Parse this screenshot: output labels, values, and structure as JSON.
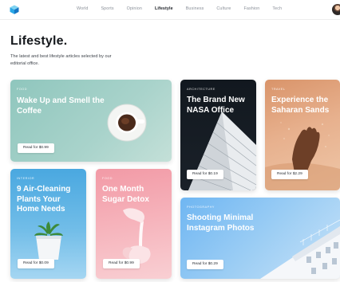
{
  "nav": {
    "items": [
      "World",
      "Sports",
      "Opinion",
      "Lifestyle",
      "Business",
      "Culture",
      "Fashion",
      "Tech"
    ],
    "active": "Lifestyle"
  },
  "header": {
    "title": "Lifestyle.",
    "description": "The latest and best lifestyle articles selected by our editorial office."
  },
  "cards": {
    "coffee": {
      "category": "FOOD",
      "title": "Wake Up and Smell the Coffee",
      "button": "Read for $0.99"
    },
    "nasa": {
      "category": "ARCHITECTURE",
      "title": "The Brand New NASA Office",
      "button": "Read for $0.19"
    },
    "sahara": {
      "category": "TRAVEL",
      "title": "Experience the Saharan Sands",
      "button": "Read for $2.29"
    },
    "plants": {
      "category": "INTERIOR",
      "title": "9 Air-Cleaning Plants Your Home Needs",
      "button": "Read for $0.09"
    },
    "sugar": {
      "category": "FOOD",
      "title": "One Month Sugar Detox",
      "button": "Read for $0.99"
    },
    "insta": {
      "category": "PHOTOGRAPHY",
      "title": "Shooting Minimal Instagram Photos",
      "button": "Read for $0.29"
    }
  },
  "colors": {
    "accent_text": "#15181c",
    "nav_muted": "#8a9099",
    "coffee_bg": "#a9d3cb",
    "nasa_bg": "#12181f",
    "sahara_bg": "#e7b08d",
    "plants_bg": "#71bde8",
    "sugar_bg": "#f6b4bc",
    "insta_bg": "#9bcdf4"
  },
  "icons": {
    "logo": "cube-logo-icon",
    "avatar": "user-avatar"
  }
}
